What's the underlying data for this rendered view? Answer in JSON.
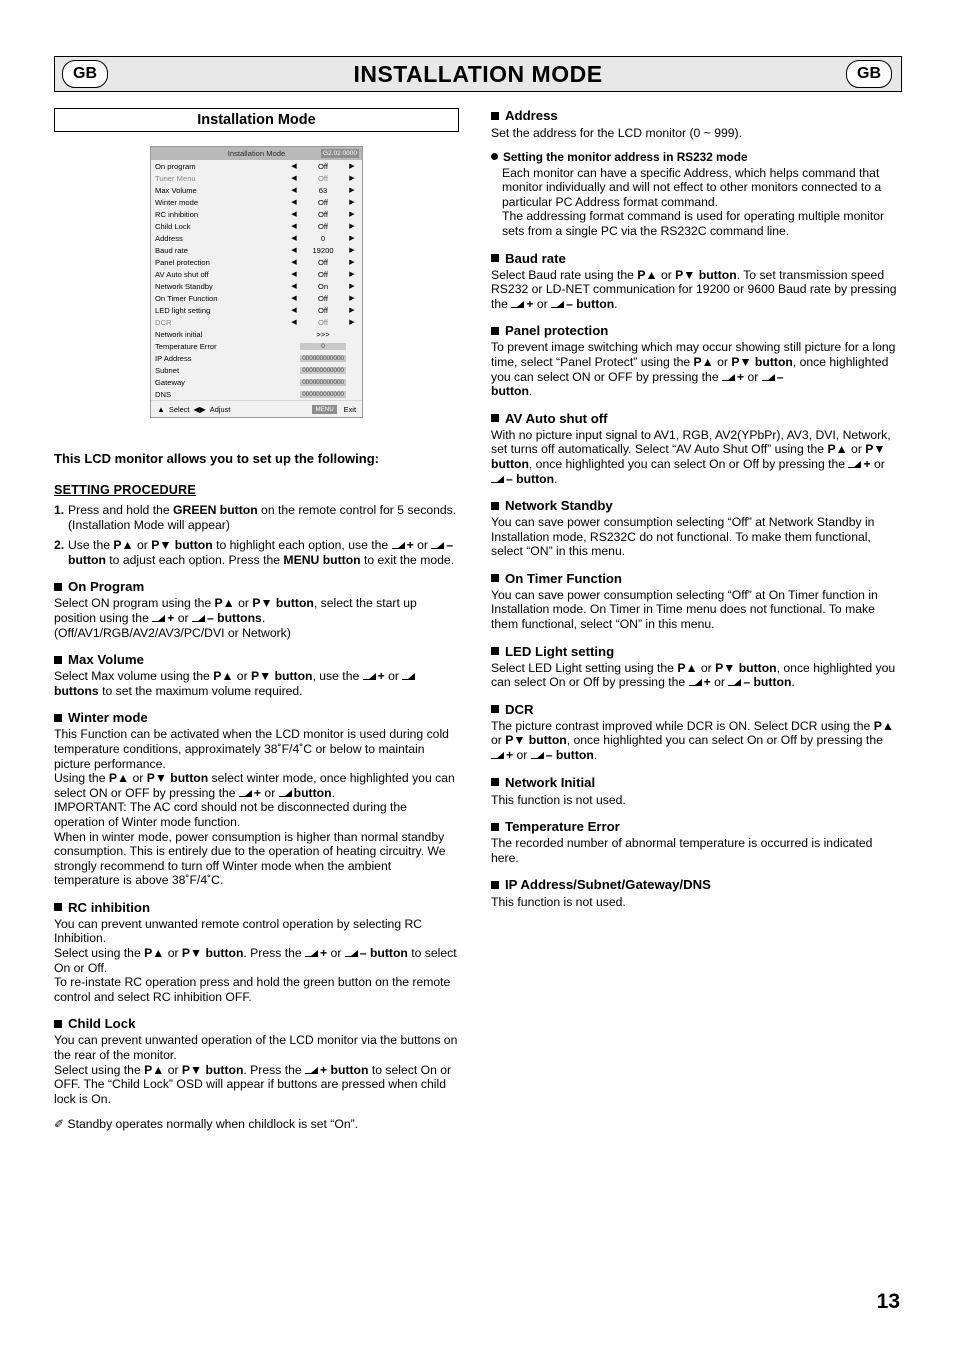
{
  "header": {
    "title": "INSTALLATION MODE",
    "badge_left": "GB",
    "badge_right": "GB"
  },
  "page_number": "13",
  "left": {
    "section_title": "Installation Mode",
    "osd": {
      "title": "Installation Mode",
      "version": "G2.02 0000",
      "rows": [
        {
          "label": "On program",
          "value": "Off",
          "arrows": true,
          "dim": false,
          "field": false
        },
        {
          "label": "Tuner Menu",
          "value": "Off",
          "arrows": true,
          "dim": true,
          "field": false
        },
        {
          "label": "Max Volume",
          "value": "63",
          "arrows": true,
          "dim": false,
          "field": false
        },
        {
          "label": "Winter mode",
          "value": "Off",
          "arrows": true,
          "dim": false,
          "field": false
        },
        {
          "label": "RC inhibition",
          "value": "Off",
          "arrows": true,
          "dim": false,
          "field": false
        },
        {
          "label": "Child Lock",
          "value": "Off",
          "arrows": true,
          "dim": false,
          "field": false
        },
        {
          "label": "Address",
          "value": "0",
          "arrows": true,
          "dim": false,
          "field": false
        },
        {
          "label": "Baud rate",
          "value": "19200",
          "arrows": true,
          "dim": false,
          "field": false
        },
        {
          "label": "Panel protection",
          "value": "Off",
          "arrows": true,
          "dim": false,
          "field": false
        },
        {
          "label": "AV Auto shut off",
          "value": "Off",
          "arrows": true,
          "dim": false,
          "field": false
        },
        {
          "label": "Network Standby",
          "value": "On",
          "arrows": true,
          "dim": false,
          "field": false
        },
        {
          "label": "On Timer Function",
          "value": "Off",
          "arrows": true,
          "dim": false,
          "field": false
        },
        {
          "label": "LED light setting",
          "value": "Off",
          "arrows": true,
          "dim": false,
          "field": false
        },
        {
          "label": "DCR",
          "value": "Off",
          "arrows": true,
          "dim": true,
          "field": false
        },
        {
          "label": "Network initial",
          "value": ">>>",
          "arrows": false,
          "dim": false,
          "field": false
        },
        {
          "label": "Temperature Error",
          "value": "0",
          "arrows": false,
          "dim": false,
          "field": true
        },
        {
          "label": "IP Address",
          "value": "000000000000",
          "arrows": false,
          "dim": false,
          "field": true
        },
        {
          "label": "Subnet",
          "value": "000000000000",
          "arrows": false,
          "dim": false,
          "field": true
        },
        {
          "label": "Gateway",
          "value": "000000000000",
          "arrows": false,
          "dim": false,
          "field": true
        },
        {
          "label": "DNS",
          "value": "000000000000",
          "arrows": false,
          "dim": false,
          "field": true
        }
      ],
      "footer": {
        "select": "Select",
        "adjust": "Adjust",
        "menu_key": "MENU",
        "exit": "Exit"
      }
    },
    "lead": "This LCD monitor allows you to set up the following:",
    "procedure_heading": "SETTING PROCEDURE",
    "step1_num": "1.",
    "step1_a": "Press and hold the ",
    "step1_b": "GREEN button",
    "step1_c": " on the remote control for 5 seconds. (Installation Mode will appear)",
    "step2_num": "2.",
    "step2_text": "Use the P▲ or P▼ button to highlight each option, use the + or – button to adjust each option. Press the MENU button to exit the mode.",
    "sections": [
      {
        "heading": "On Program",
        "body": "Select ON program using the P▲ or P▼ button, select the start up position using the + or – buttons. (Off/AV1/RGB/AV2/AV3/PC/DVI or Network)"
      },
      {
        "heading": "Max Volume",
        "body": "Select Max volume using the P▲ or P▼ button, use the + or – buttons to set the maximum volume required."
      },
      {
        "heading": "Winter mode",
        "body": "This Function can be activated when the LCD monitor is used during cold temperature conditions, approximately 38˚F/4˚C or below to maintain picture performance. Using the P▲ or P▼ button select winter mode, once highlighted you can select ON or OFF by pressing the + or – button. IMPORTANT: The AC cord should not be disconnected during the operation of Winter mode function. When in winter mode, power consumption is higher than normal standby consumption. This is entirely due to the operation of heating circuitry. We strongly recommend to turn off Winter mode when the ambient temperature is above 38˚F/4˚C."
      },
      {
        "heading": "RC inhibition",
        "body": "You can prevent unwanted remote control operation by selecting RC Inhibition. Select using the P▲ or P▼ button. Press the + or – button to select On or Off. To re-instate RC operation press and hold the green button on the remote control and select RC inhibition OFF."
      },
      {
        "heading": "Child Lock",
        "body": "You can prevent unwanted operation of the LCD monitor via the buttons on the rear of the monitor. Select using the P▲ or P▼ button. Press the + button to select On or OFF. The “Child Lock” OSD will appear if buttons are pressed when child lock is On."
      }
    ],
    "note": "Standby operates normally when childlock is set “On”."
  },
  "right": {
    "sections": [
      {
        "heading": "Address",
        "body": "Set the address for the LCD monitor (0 ~ 999).",
        "sub_heading": "Setting the monitor address in RS232 mode",
        "sub_body": "Each monitor can have a specific Address, which helps command that monitor individually and will not effect to other monitors connected to a particular PC Address format command. The addressing format command is used for operating multiple monitor sets from a single PC via the RS232C command line."
      },
      {
        "heading": "Baud rate",
        "body": "Select Baud rate using the P▲ or P▼ button. To set transmission speed RS232 or LD-NET communication for 19200 or 9600 Baud rate by pressing the + or – button."
      },
      {
        "heading": "Panel protection",
        "body": "To prevent image switching which may occur showing still picture for a long time, select “Panel Protect” using the P▲ or P▼ button, once highlighted you can select ON or OFF by pressing the + or – button."
      },
      {
        "heading": "AV Auto shut off",
        "body": "With no picture input signal to AV1, RGB, AV2(YPbPr), AV3, DVI, Network, set turns off automatically. Select “AV Auto Shut Off” using the P▲ or P▼ button, once highlighted you can select On or Off by pressing the + or – button."
      },
      {
        "heading": "Network Standby",
        "body": "You can save power consumption selecting “Off” at Network Standby in Installation mode, RS232C do not functional. To make them functional, select “ON” in this menu."
      },
      {
        "heading": "On Timer Function",
        "body": "You can save power consumption selecting “Off” at On Timer function in Installation mode. On Timer in Time menu does not functional. To make them functional, select “ON” in this menu."
      },
      {
        "heading": "LED Light setting",
        "body": "Select LED Light setting using the P▲ or P▼ button, once highlighted you can select On or Off by pressing the + or – button."
      },
      {
        "heading": "DCR",
        "body": "The picture contrast improved while DCR is ON. Select DCR using the P▲ or P▼ button, once highlighted you can select On or Off by pressing the + or – button."
      },
      {
        "heading": "Network Initial",
        "body": "This function is not used."
      },
      {
        "heading": "Temperature Error",
        "body": "The recorded number of abnormal temperature is occurred is indicated here."
      },
      {
        "heading": "IP Address/Subnet/Gateway/DNS",
        "body": "This function is not used."
      }
    ]
  }
}
